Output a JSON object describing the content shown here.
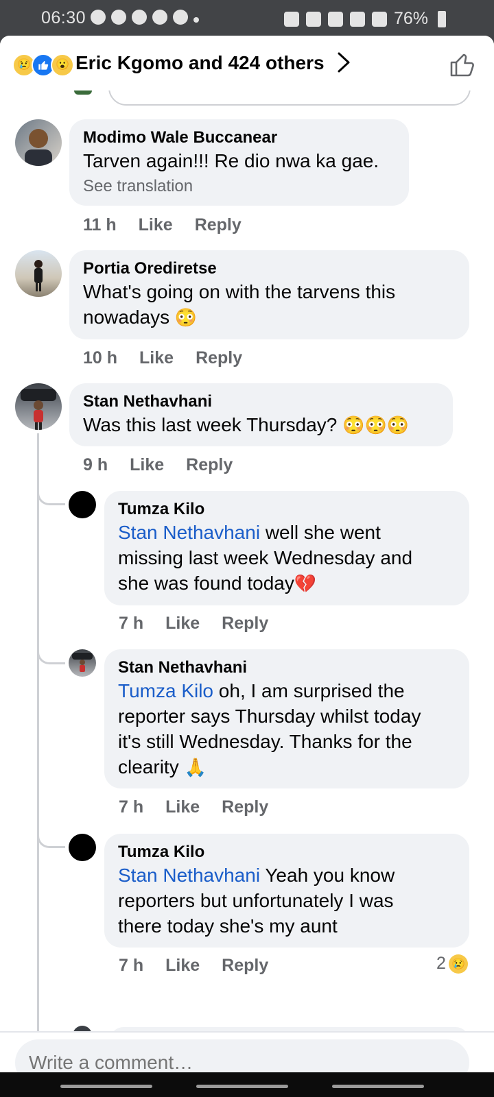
{
  "status_bar": {
    "time": "06:30",
    "battery": "76%"
  },
  "header": {
    "reactors": "Eric Kgomo and 424 others",
    "reactions": [
      "sad",
      "like",
      "wow"
    ]
  },
  "comments": [
    {
      "author": "Modimo Wale Buccanear",
      "text": "Tarven again!!! Re dio nwa ka gae.",
      "see_translation": "See translation",
      "time": "11 h",
      "like": "Like",
      "reply": "Reply"
    },
    {
      "author": "Portia Orediretse",
      "text_line1": "What's going on with the tarvens this",
      "text_line2": "nowadays",
      "emoji": "😳",
      "time": "10 h",
      "like": "Like",
      "reply": "Reply"
    },
    {
      "author": "Stan Nethavhani",
      "text": "Was this last week Thursday?",
      "emoji": "😳😳😳",
      "time": "9 h",
      "like": "Like",
      "reply": "Reply"
    }
  ],
  "replies": [
    {
      "author": "Tumza Kilo",
      "mention": "Stan Nethavhani",
      "text_line1": " well she went",
      "text_line2": "missing last week Wednesday and",
      "text_line3": "she was found today",
      "emoji": "💔",
      "time": "7 h",
      "like": "Like",
      "reply": "Reply"
    },
    {
      "author": "Stan Nethavhani",
      "mention": "Tumza Kilo",
      "text_line1": " oh, I am surprised the",
      "text_line2": "reporter says Thursday whilst today",
      "text_line3": "it's still Wednesday. Thanks for the",
      "text_line4": "clearity",
      "emoji": "🙏",
      "time": "7 h",
      "like": "Like",
      "reply": "Reply"
    },
    {
      "author": "Tumza Kilo",
      "mention": "Stan Nethavhani",
      "text_line1": " Yeah you know",
      "text_line2": "reporters but unfortunately I was",
      "text_line3": "there today she's my aunt",
      "time": "7 h",
      "like": "Like",
      "reply": "Reply",
      "reaction_count": "2"
    }
  ],
  "composer": {
    "placeholder": "Write a comment…"
  }
}
